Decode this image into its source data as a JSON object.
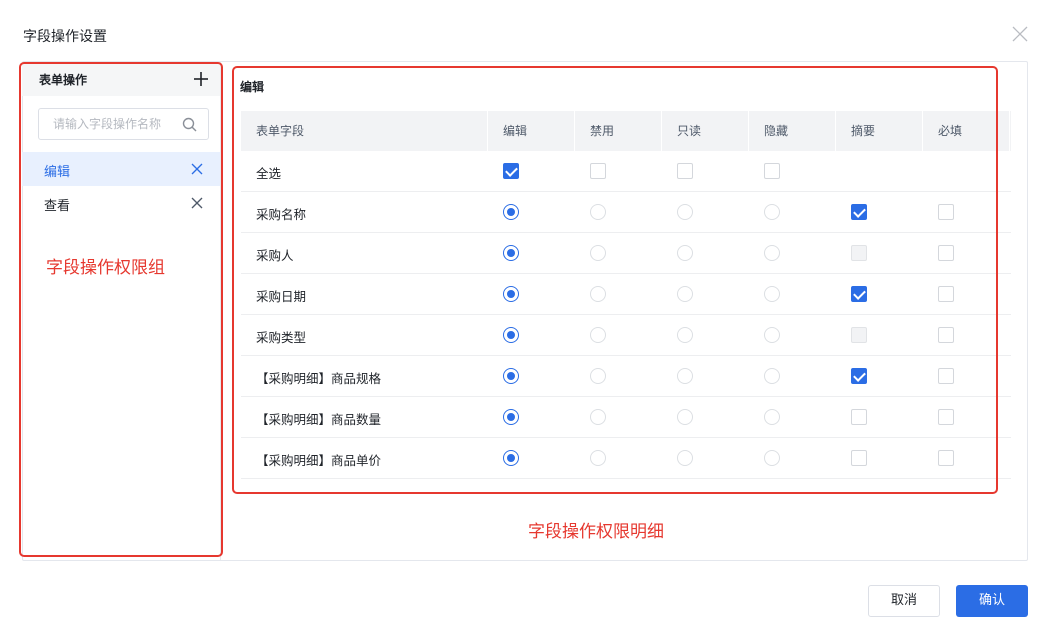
{
  "dialog": {
    "title": "字段操作设置",
    "close_icon": "close-icon"
  },
  "left_panel": {
    "title": "表单操作",
    "add_icon": "plus-icon",
    "search": {
      "placeholder": "请输入字段操作名称",
      "value": "",
      "icon": "search-icon"
    },
    "items": [
      {
        "label": "编辑",
        "active": true,
        "delete_icon": "close-icon"
      },
      {
        "label": "查看",
        "active": false,
        "delete_icon": "close-icon"
      }
    ]
  },
  "annotations": {
    "left": "字段操作权限组",
    "right": "字段操作权限明细",
    "color": "#e6382f"
  },
  "main": {
    "section_title": "编辑",
    "columns": [
      "表单字段",
      "编辑",
      "禁用",
      "只读",
      "隐藏",
      "摘要",
      "必填"
    ],
    "rows": [
      {
        "label": "全选",
        "edit": "checkbox-checked",
        "disabled": "checkbox",
        "readonly": "checkbox",
        "hidden": "checkbox",
        "summary": "none",
        "required": "none"
      },
      {
        "label": "采购名称",
        "edit": "radio-selected",
        "disabled": "radio",
        "readonly": "radio",
        "hidden": "radio",
        "summary": "checked",
        "required": "unchecked"
      },
      {
        "label": "采购人",
        "edit": "radio-selected",
        "disabled": "radio",
        "readonly": "radio",
        "hidden": "radio",
        "summary": "disabled",
        "required": "unchecked"
      },
      {
        "label": "采购日期",
        "edit": "radio-selected",
        "disabled": "radio",
        "readonly": "radio",
        "hidden": "radio",
        "summary": "checked",
        "required": "unchecked"
      },
      {
        "label": "采购类型",
        "edit": "radio-selected",
        "disabled": "radio",
        "readonly": "radio",
        "hidden": "radio",
        "summary": "disabled",
        "required": "unchecked"
      },
      {
        "label": "【采购明细】商品规格",
        "edit": "radio-selected",
        "disabled": "radio",
        "readonly": "radio",
        "hidden": "radio",
        "summary": "checked",
        "required": "unchecked"
      },
      {
        "label": "【采购明细】商品数量",
        "edit": "radio-selected",
        "disabled": "radio",
        "readonly": "radio",
        "hidden": "radio",
        "summary": "unchecked",
        "required": "unchecked"
      },
      {
        "label": "【采购明细】商品单价",
        "edit": "radio-selected",
        "disabled": "radio",
        "readonly": "radio",
        "hidden": "radio",
        "summary": "unchecked",
        "required": "unchecked"
      }
    ]
  },
  "footer": {
    "cancel_label": "取消",
    "ok_label": "确认"
  },
  "colors": {
    "primary": "#2b6de5",
    "active_item_bg": "#e8f0fe",
    "header_bg": "#f2f3f5"
  }
}
